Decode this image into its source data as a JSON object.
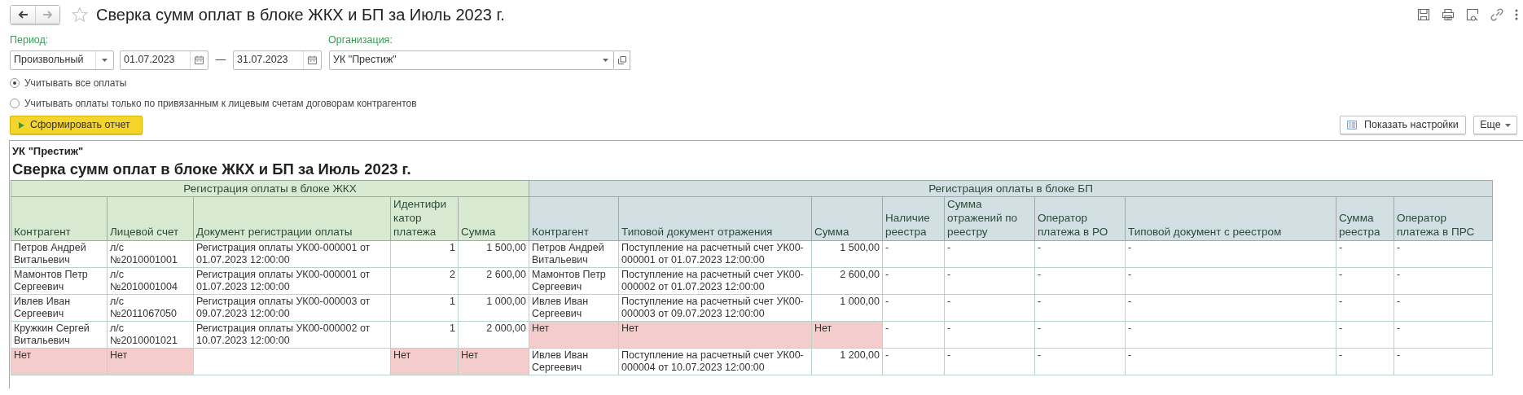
{
  "window": {
    "title": "Сверка сумм оплат в блоке ЖКХ и БП за Июль 2023 г."
  },
  "nav": [
    {
      "kind": "back",
      "disabled": false
    },
    {
      "kind": "forward",
      "disabled": true
    }
  ],
  "filters": {
    "period_label": "Период:",
    "period_kind": "Произвольный",
    "date_from": "01.07.2023",
    "separator": "—",
    "date_to": "31.07.2023",
    "organization_label": "Организация:",
    "organization": "УК \"Престиж\""
  },
  "payment_options": [
    {
      "label": "Учитывать все оплаты",
      "selected": true
    },
    {
      "label": "Учитывать оплаты только по привязанным к лицевым счетам договорам контрагентов",
      "selected": false
    }
  ],
  "buttons": {
    "generate": "Сформировать отчет",
    "settings": "Показать настройки",
    "more": "Еще"
  },
  "report": {
    "organization": "УК \"Престиж\"",
    "title": "Сверка сумм оплат в блоке ЖКХ и БП за Июль 2023 г.",
    "groups": [
      {
        "label": "Регистрация оплаты в блоке ЖКХ",
        "kind": "zhkh",
        "columns": [
          {
            "label": "Контрагент",
            "kind": "text"
          },
          {
            "label": "Лицевой счет",
            "kind": "text"
          },
          {
            "label": "Документ регистрации оплаты",
            "kind": "text"
          },
          {
            "label": "Идентифи катор платежа",
            "kind": "number"
          },
          {
            "label": "Сумма",
            "kind": "number"
          }
        ]
      },
      {
        "label": "Регистрация оплаты в блоке БП",
        "kind": "bp",
        "columns": [
          {
            "label": "Контрагент",
            "kind": "text"
          },
          {
            "label": "Типовой документ отражения",
            "kind": "text"
          },
          {
            "label": "Сумма",
            "kind": "number"
          },
          {
            "label": "Наличие реестра",
            "kind": "text"
          },
          {
            "label": "Сумма отражений по реестру",
            "kind": "text"
          },
          {
            "label": "Оператор платежа в РО",
            "kind": "text"
          },
          {
            "label": "Типовой документ с реестром",
            "kind": "text"
          },
          {
            "label": "Сумма реестра",
            "kind": "text"
          },
          {
            "label": "Оператор платежа в ПРС",
            "kind": "text"
          }
        ]
      }
    ],
    "rows": [
      {
        "cells": [
          {
            "text": "Петров Андрей Витальевич",
            "missing": false
          },
          {
            "text": "л/с №2010001001",
            "missing": false
          },
          {
            "text": "Регистрация оплаты УК00-000001 от 01.07.2023 12:00:00",
            "missing": false
          },
          {
            "text": "1",
            "missing": false
          },
          {
            "text": "1 500,00",
            "missing": false
          },
          {
            "text": "Петров Андрей Витальевич",
            "missing": false
          },
          {
            "text": "Поступление на расчетный счет УК00-000001 от 01.07.2023 12:00:00",
            "missing": false
          },
          {
            "text": "1 500,00",
            "missing": false
          },
          {
            "text": "-",
            "missing": false
          },
          {
            "text": "-",
            "missing": false
          },
          {
            "text": "-",
            "missing": false
          },
          {
            "text": "-",
            "missing": false
          },
          {
            "text": "-",
            "missing": false
          },
          {
            "text": "-",
            "missing": false
          }
        ]
      },
      {
        "cells": [
          {
            "text": "Мамонтов Петр Сергеевич",
            "missing": false
          },
          {
            "text": "л/с №2010001004",
            "missing": false
          },
          {
            "text": "Регистрация оплаты УК00-000001 от 01.07.2023 12:00:00",
            "missing": false
          },
          {
            "text": "2",
            "missing": false
          },
          {
            "text": "2 600,00",
            "missing": false
          },
          {
            "text": "Мамонтов Петр Сергеевич",
            "missing": false
          },
          {
            "text": "Поступление на расчетный счет УК00-000002 от 01.07.2023 12:00:00",
            "missing": false
          },
          {
            "text": "2 600,00",
            "missing": false
          },
          {
            "text": "-",
            "missing": false
          },
          {
            "text": "-",
            "missing": false
          },
          {
            "text": "-",
            "missing": false
          },
          {
            "text": "-",
            "missing": false
          },
          {
            "text": "-",
            "missing": false
          },
          {
            "text": "-",
            "missing": false
          }
        ]
      },
      {
        "cells": [
          {
            "text": "Ивлев Иван Сергеевич",
            "missing": false
          },
          {
            "text": "л/с №2011067050",
            "missing": false
          },
          {
            "text": "Регистрация оплаты УК00-000003 от 09.07.2023 12:00:00",
            "missing": false
          },
          {
            "text": "1",
            "missing": false
          },
          {
            "text": "1 000,00",
            "missing": false
          },
          {
            "text": "Ивлев Иван Сергеевич",
            "missing": false
          },
          {
            "text": "Поступление на расчетный счет УК00-000003 от 09.07.2023 12:00:00",
            "missing": false
          },
          {
            "text": "1 000,00",
            "missing": false
          },
          {
            "text": "-",
            "missing": false
          },
          {
            "text": "-",
            "missing": false
          },
          {
            "text": "-",
            "missing": false
          },
          {
            "text": "-",
            "missing": false
          },
          {
            "text": "-",
            "missing": false
          },
          {
            "text": "-",
            "missing": false
          }
        ]
      },
      {
        "cells": [
          {
            "text": "Кружкин Сергей Витальевич",
            "missing": false
          },
          {
            "text": "л/с №2010001021",
            "missing": false
          },
          {
            "text": "Регистрация оплаты УК00-000002 от 10.07.2023 12:00:00",
            "missing": false
          },
          {
            "text": "1",
            "missing": false
          },
          {
            "text": "2 000,00",
            "missing": false
          },
          {
            "text": "Нет",
            "missing": true
          },
          {
            "text": "Нет",
            "missing": true
          },
          {
            "text": "Нет",
            "missing": true
          },
          {
            "text": "-",
            "missing": false
          },
          {
            "text": "-",
            "missing": false
          },
          {
            "text": "-",
            "missing": false
          },
          {
            "text": "-",
            "missing": false
          },
          {
            "text": "-",
            "missing": false
          },
          {
            "text": "-",
            "missing": false
          }
        ]
      },
      {
        "cells": [
          {
            "text": "Нет",
            "missing": true
          },
          {
            "text": "Нет",
            "missing": true
          },
          {
            "missing": false
          },
          {
            "text": "Нет",
            "missing": true
          },
          {
            "text": "Нет",
            "missing": true
          },
          {
            "text": "Ивлев Иван Сергеевич",
            "missing": false
          },
          {
            "text": "Поступление на расчетный счет УК00-000004 от 10.07.2023 12:00:00",
            "missing": false
          },
          {
            "text": "1 200,00",
            "missing": false
          },
          {
            "text": "-",
            "missing": false
          },
          {
            "text": "-",
            "missing": false
          },
          {
            "text": "-",
            "missing": false
          },
          {
            "text": "-",
            "missing": false
          },
          {
            "text": "-",
            "missing": false
          },
          {
            "text": "-",
            "missing": false
          }
        ]
      }
    ]
  }
}
